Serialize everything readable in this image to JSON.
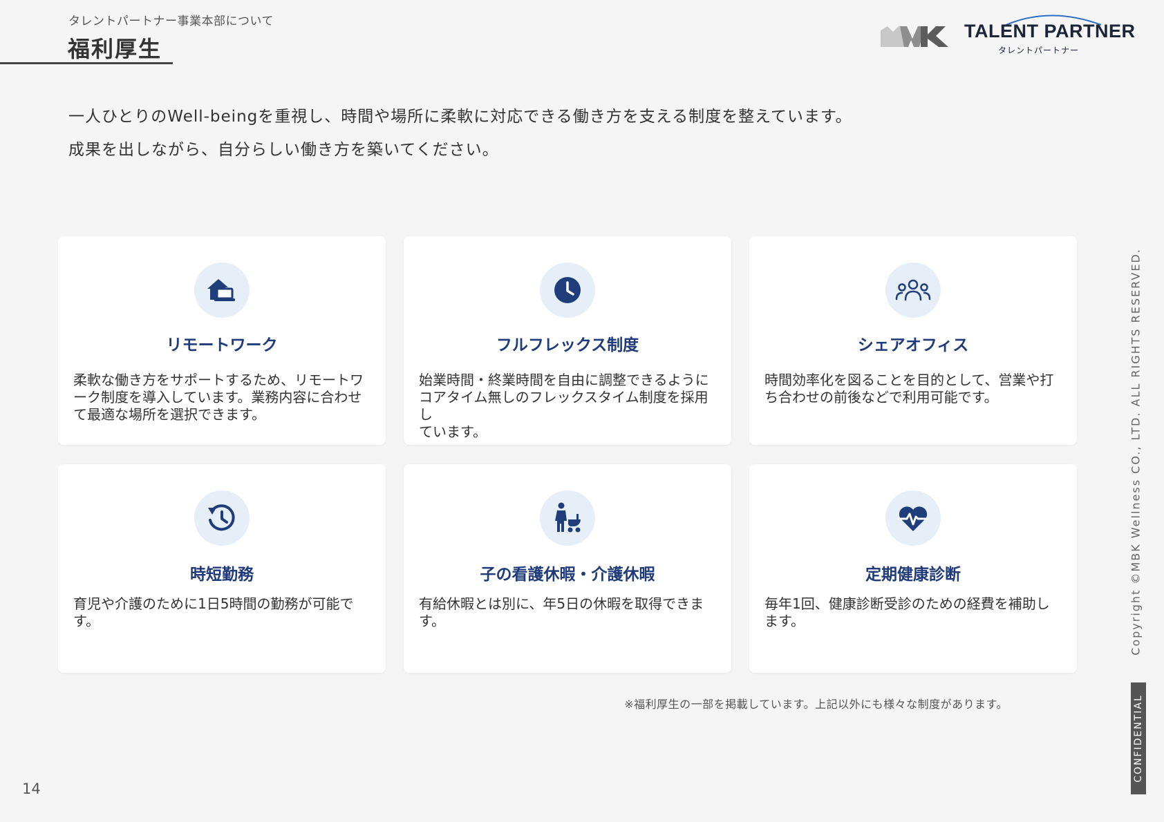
{
  "header": {
    "breadcrumb": "タレントパートナー事業本部について",
    "title": "福利厚生",
    "logo": {
      "text": "TALENT PARTNER",
      "subtext": "タレントパートナー",
      "mark": "MWK"
    }
  },
  "lead": {
    "line1": "一人ひとりのWell-beingを重視し、時間や場所に柔軟に対応できる働き方を支える制度を整えています。",
    "line2": "成果を出しながら、自分らしい働き方を築いてください。"
  },
  "cards": [
    {
      "icon": "home-laptop-icon",
      "title": "リモートワーク",
      "desc_lines": [
        "柔軟な働き方をサポートするため、リモートワ",
        "ーク制度を導入しています。業務内容に合わせ",
        "て最適な場所を選択できます。"
      ]
    },
    {
      "icon": "clock-icon",
      "title": "フルフレックス制度",
      "desc_lines": [
        "始業時間・終業時間を自由に調整できるように",
        "コアタイム無しのフレックスタイム制度を採用し",
        "ています。"
      ]
    },
    {
      "icon": "people-icon",
      "title": "シェアオフィス",
      "desc_lines": [
        "時間効率化を図ることを目的として、営業や打",
        "ち合わせの前後などで利用可能です。"
      ]
    },
    {
      "icon": "history-clock-icon",
      "title": "時短勤務",
      "desc_lines": [
        "育児や介護のために1日5時間の勤務が可能で",
        "す。"
      ]
    },
    {
      "icon": "parent-stroller-icon",
      "title": "子の看護休暇・介護休暇",
      "desc_lines": [
        "有給休暇とは別に、年5日の休暇を取得できま",
        "す。"
      ]
    },
    {
      "icon": "heart-pulse-icon",
      "title": "定期健康診断",
      "desc_lines": [
        "毎年1回、健康診断受診のための経費を補助し",
        "ます。"
      ]
    }
  ],
  "footnote": "※福利厚生の一部を掲載しています。上記以外にも様々な制度があります。",
  "page_number": "14",
  "copyright": "Copyright ©MBK Wellness CO., LTD. ALL RIGHTS RESERVED.",
  "confidential": "CONFIDENTIAL",
  "colors": {
    "accent": "#1f3a78",
    "icon_bg": "#e6eef8",
    "icon_fg": "#1e3d7a",
    "page_bg": "#f5f5f5",
    "card_bg": "#ffffff"
  }
}
